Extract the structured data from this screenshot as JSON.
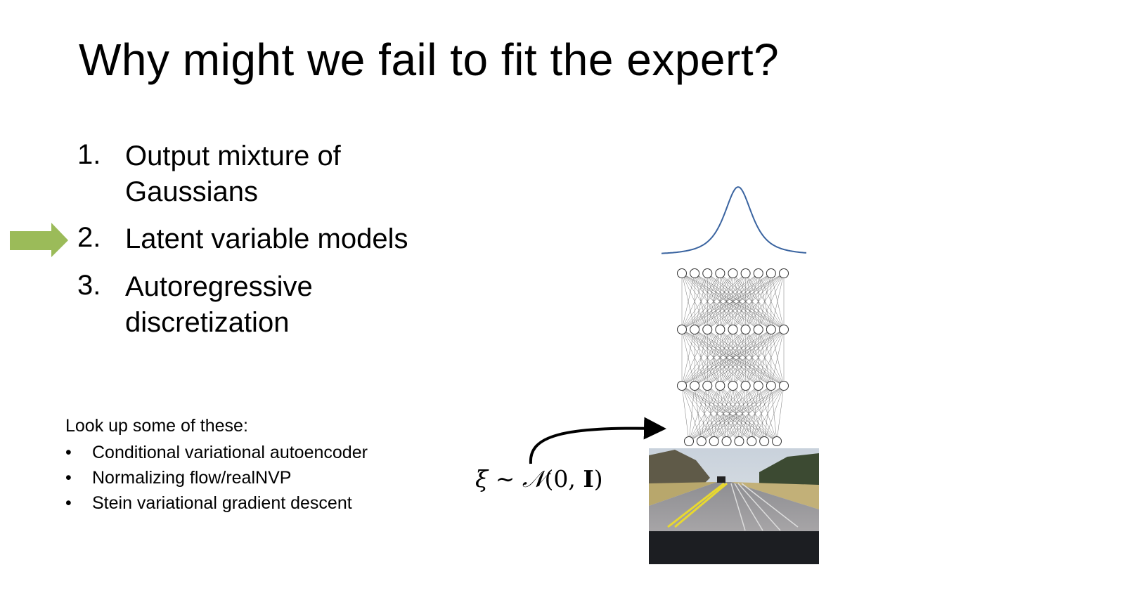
{
  "slide": {
    "title": "Why might we fail to fit the expert?",
    "list": [
      {
        "number": "1.",
        "text_line1": "Output mixture of",
        "text_line2": "Gaussians"
      },
      {
        "number": "2.",
        "text_line1": "Latent variable models"
      },
      {
        "number": "3.",
        "text_line1": "Autoregressive",
        "text_line2": "discretization"
      }
    ],
    "highlighted_item": 2,
    "arrow_color": "#9bbb59",
    "lookup": {
      "heading": "Look up some of these:",
      "items": [
        "Conditional variational autoencoder",
        "Normalizing flow/realNVP",
        "Stein variational gradient descent"
      ],
      "bullet": "•"
    },
    "formula": {
      "xi": "ξ",
      "sim": " ∼ ",
      "N": "𝒩",
      "args_open": "(0, ",
      "I": "I",
      "args_close": ")"
    },
    "diagram": {
      "curve_color": "#3a64a0",
      "layers": [
        9,
        9,
        9,
        8
      ]
    }
  }
}
